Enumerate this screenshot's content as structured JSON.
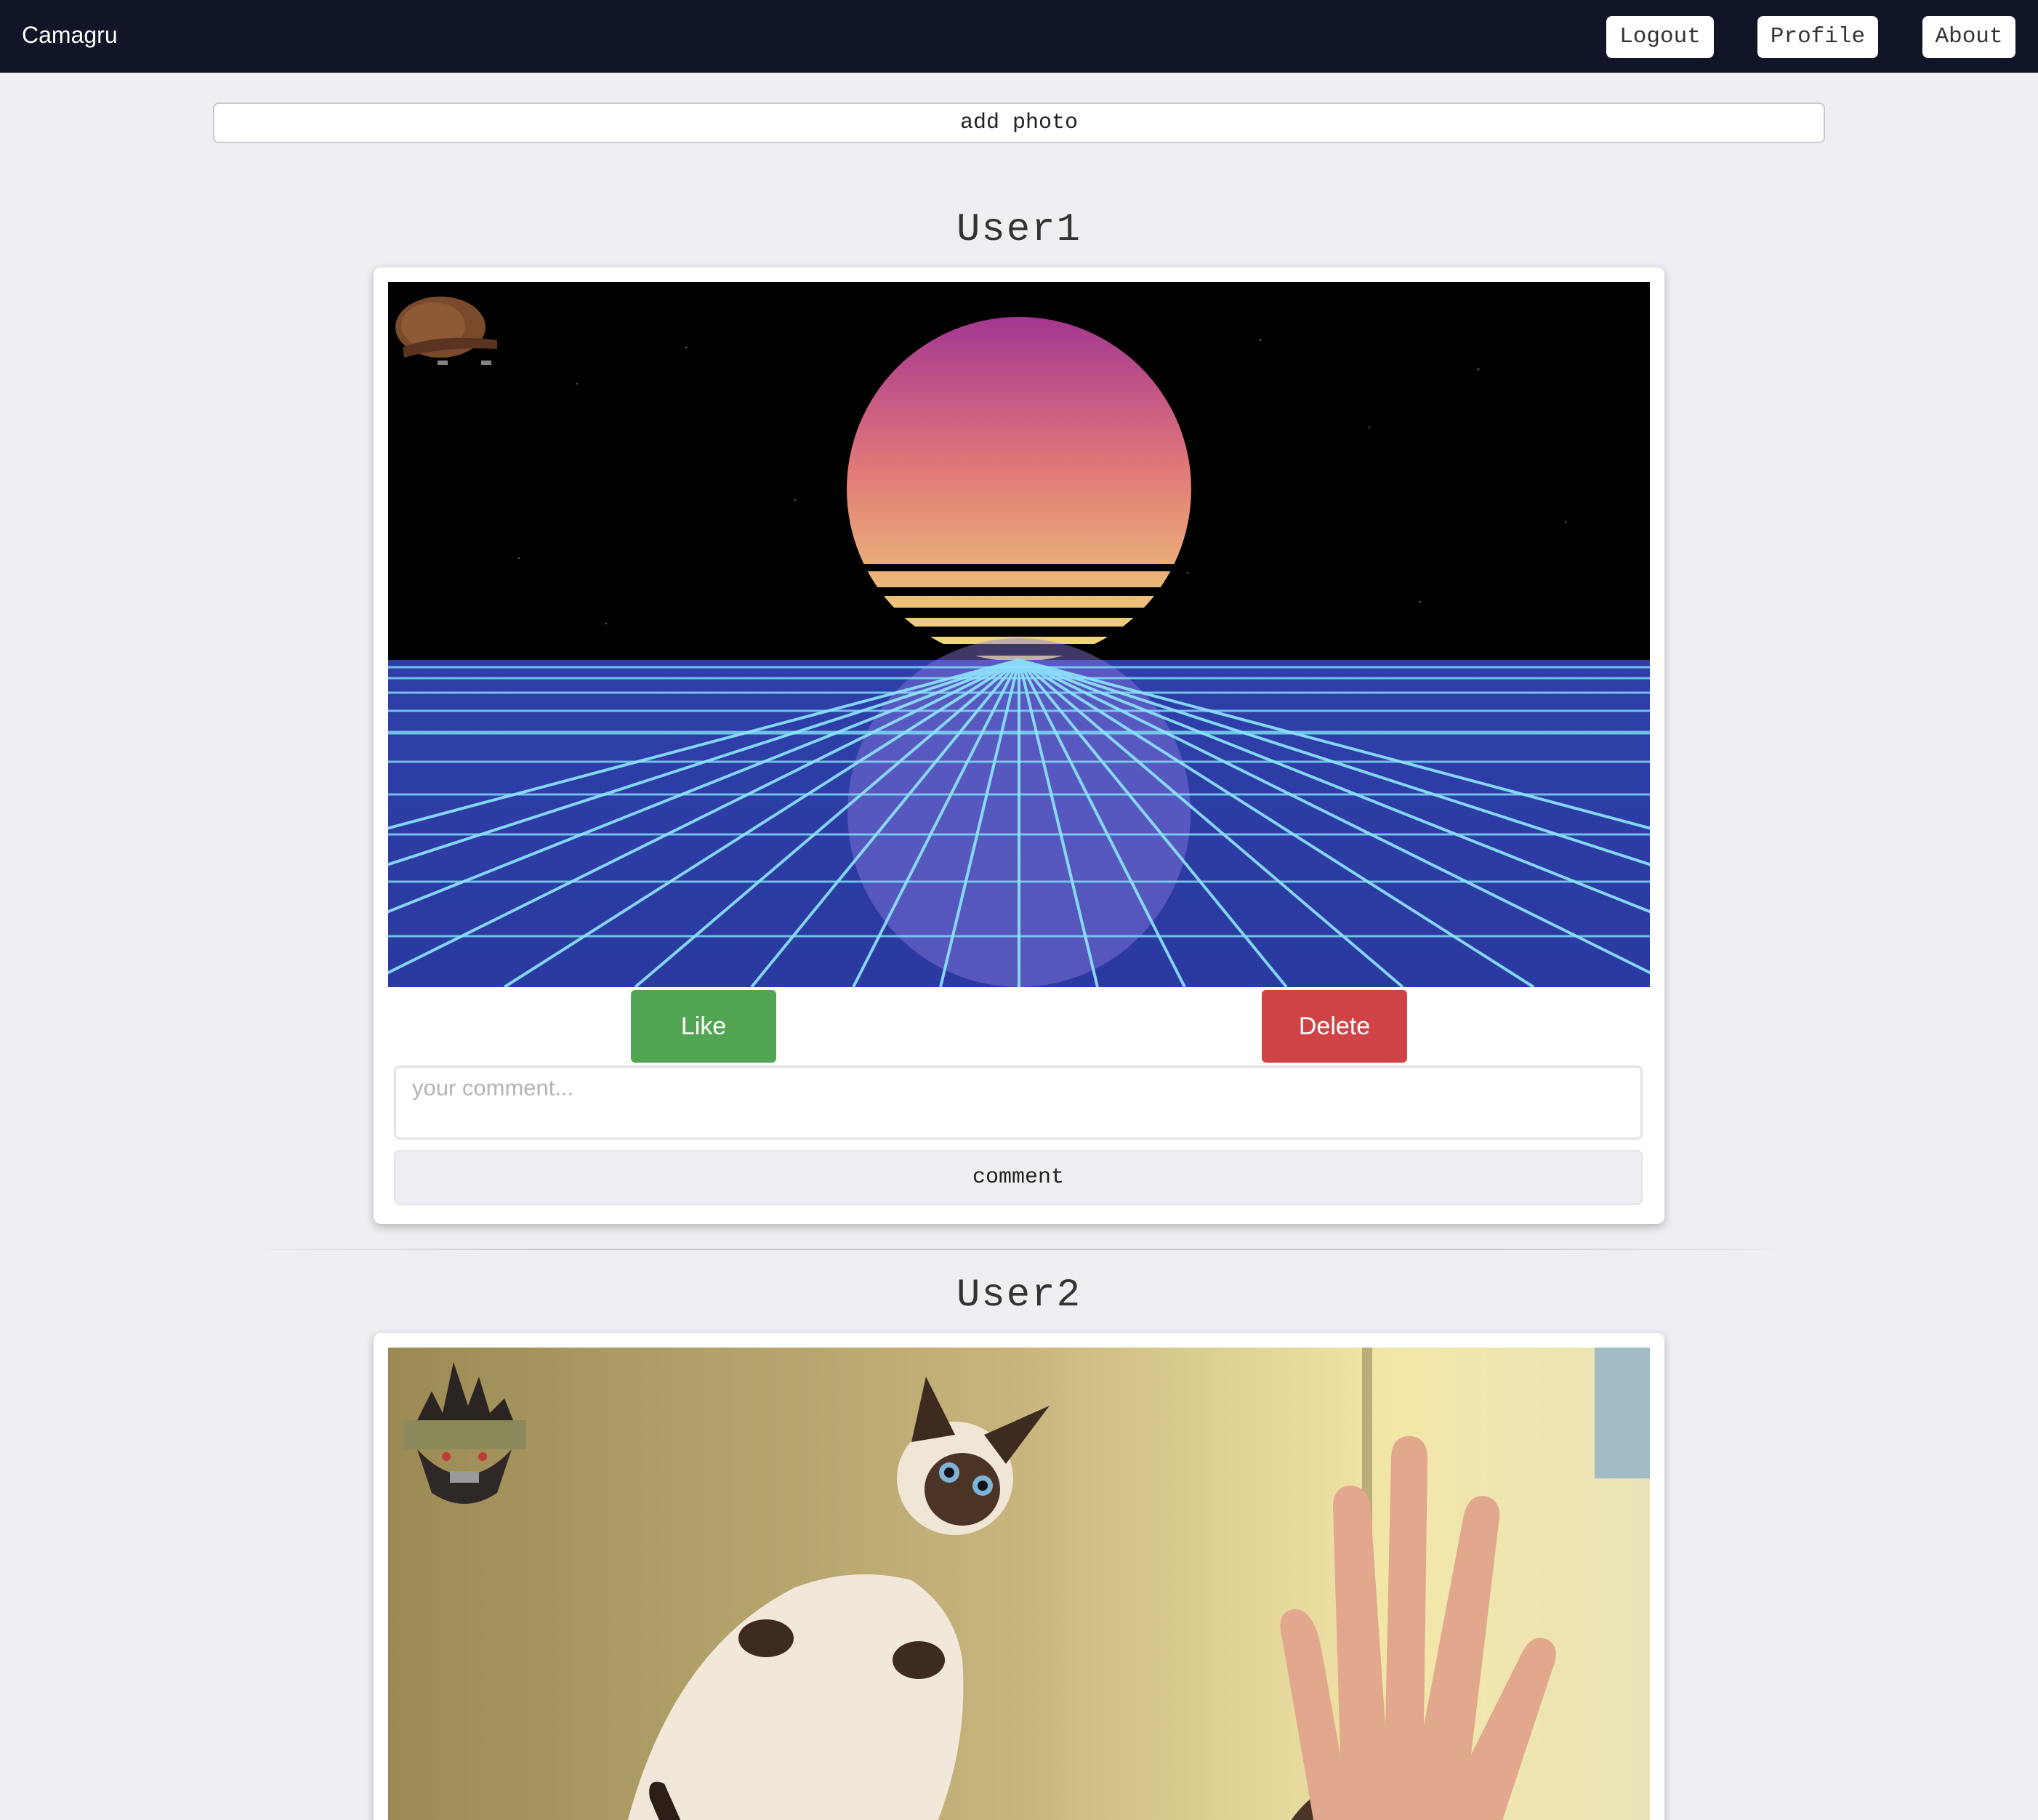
{
  "navbar": {
    "brand": "Camagru",
    "logout_label": "Logout",
    "profile_label": "Profile",
    "about_label": "About",
    "background": "#111528"
  },
  "add_photo_label": "add photo",
  "posts": [
    {
      "username": "User1",
      "image": "synthwave-sunset-grid",
      "sticker": "scumbag-hat-sticker",
      "like_label": "Like",
      "delete_label": "Delete",
      "comment_placeholder": "your comment...",
      "comment_label": "comment"
    },
    {
      "username": "User2",
      "image": "siamese-cat-high-five",
      "sticker": "monster-head-sticker"
    }
  ],
  "colors": {
    "like": "#52a552",
    "delete": "#cf4347",
    "page_background": "#efeff3"
  }
}
